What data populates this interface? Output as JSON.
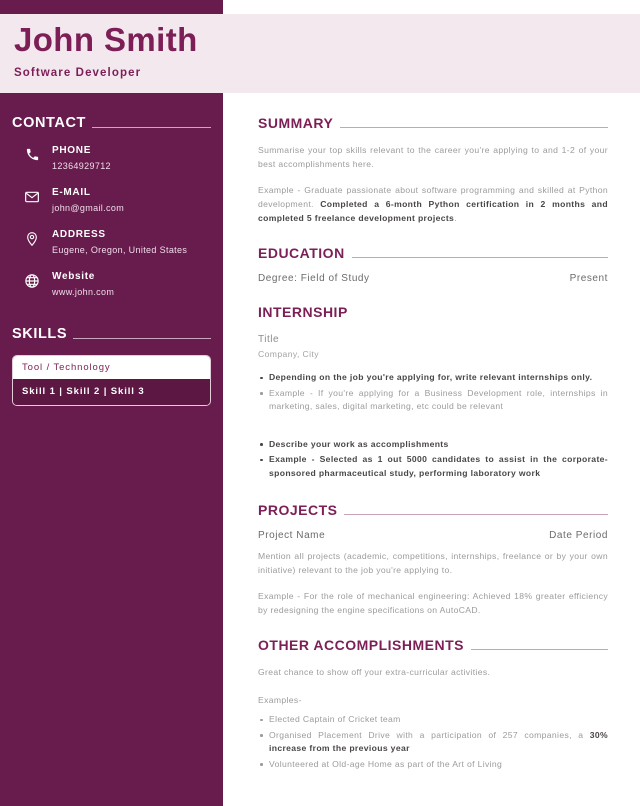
{
  "header": {
    "name": "John Smith",
    "job_title": "Software  Developer"
  },
  "colors": {
    "sidebar_bg": "#681c4d",
    "header_band_bg": "#f4e8ef",
    "accent": "#7c1f56",
    "skills_body_bg": "#5c1743",
    "body_text": "#9d9a9b",
    "emphasis_text": "#4a4648"
  },
  "sidebar": {
    "contact": {
      "heading": "CONTACT",
      "items": [
        {
          "icon": "phone-icon",
          "label": "PHONE",
          "value": "12364929712"
        },
        {
          "icon": "envelope-icon",
          "label": "E-MAIL",
          "value": "john@gmail.com"
        },
        {
          "icon": "map-pin-icon",
          "label": "ADDRESS",
          "value": "Eugene,  Oregon,  United  States"
        },
        {
          "icon": "globe-icon",
          "label": "Website",
          "value": "www.john.com"
        }
      ]
    },
    "skills": {
      "heading": "SKILLS",
      "box_header": "Tool  /  Technology",
      "box_body": "Skill  1  |  Skill  2  |  Skill  3"
    }
  },
  "main": {
    "summary": {
      "heading": "SUMMARY",
      "paragraph_1": "Summarise your top skills relevant to the career you're applying to and 1-2 of your best accomplishments here.",
      "paragraph_2_plain": "Example - Graduate passionate about software programming and skilled at Python development. ",
      "paragraph_2_bold": "Completed a 6-month Python certification in 2 months and completed 5 freelance development projects",
      "paragraph_2_tail": "."
    },
    "education": {
      "heading": "EDUCATION",
      "degree": "Degree: Field of Study",
      "date": "Present"
    },
    "internship": {
      "heading": "INTERNSHIP",
      "title": "Title",
      "company": "Company,  City",
      "bullets_group_1": [
        {
          "text": "Depending on the job you're applying for, write relevant internships only.",
          "bold": true
        },
        {
          "text": "Example - If you're applying for a Business Development role, internships in marketing, sales, digital marketing, etc could be relevant",
          "bold": false
        }
      ],
      "bullets_group_2": [
        {
          "text": "Describe your work as accomplishments",
          "bold": true
        },
        {
          "text": "Example - Selected as 1 out 5000 candidates to assist in the corporate- sponsored pharmaceutical study, performing laboratory work",
          "bold": true
        }
      ]
    },
    "projects": {
      "heading": "PROJECTS",
      "project_name": "Project Name",
      "date_period": "Date  Period",
      "paragraph_1": "Mention all projects (academic, competitions, internships, freelance or by your own initiative) relevant to the job you're applying to.",
      "paragraph_2": "Example - For the role of mechanical engineering: Achieved 18% greater efficiency by redesigning the engine specifications on AutoCAD."
    },
    "other": {
      "heading": "OTHER ACCOMPLISHMENTS",
      "paragraph_1": "Great chance to show off your extra-curricular activities.",
      "examples_label": "Examples-",
      "bullets": [
        {
          "pre": "Elected Captain of Cricket team",
          "bold": "",
          "post": ""
        },
        {
          "pre": "Organised Placement Drive with a participation of 257 companies, a ",
          "bold": "30% increase from the previous year",
          "post": ""
        },
        {
          "pre": "Volunteered at Old-age Home as part of the Art of Living",
          "bold": "",
          "post": ""
        }
      ]
    }
  }
}
